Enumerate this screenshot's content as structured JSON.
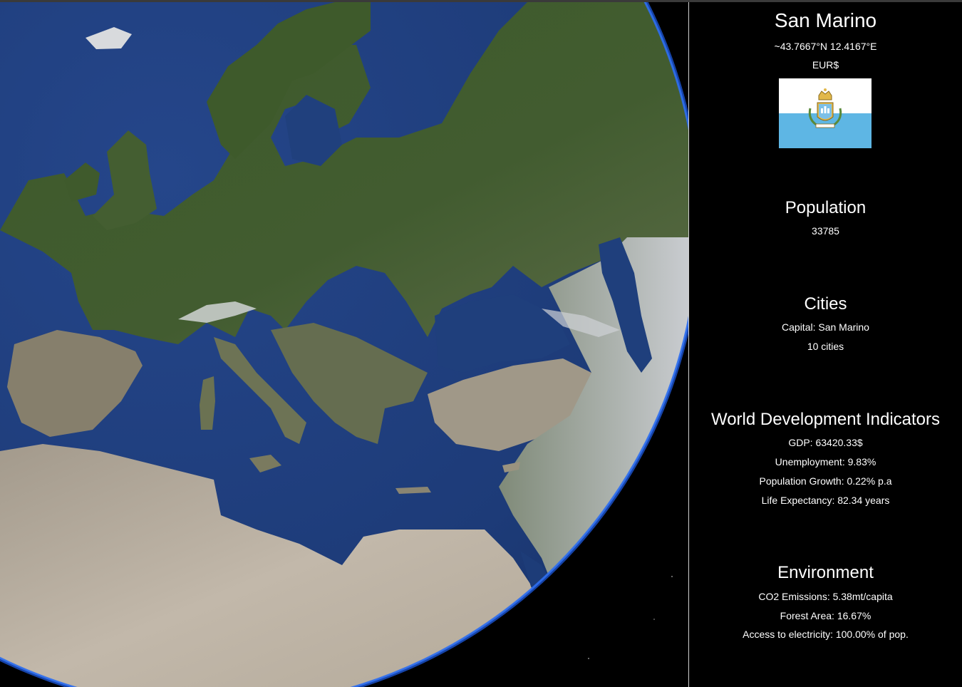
{
  "country": {
    "name": "San Marino",
    "coordinates": "~43.7667°N 12.4167°E",
    "currency": "EUR$",
    "flag": {
      "top_color": "#ffffff",
      "bottom_color": "#5eb6e4",
      "emblem_icon": "san-marino-coat-of-arms-icon"
    }
  },
  "population": {
    "title": "Population",
    "value": "33785"
  },
  "cities": {
    "title": "Cities",
    "capital": "Capital: San Marino",
    "count": "10 cities"
  },
  "wdi": {
    "title": "World Development Indicators",
    "gdp": "GDP: 63420.33$",
    "unemployment": "Unemployment: 9.83%",
    "population_growth": "Population Growth: 0.22% p.a",
    "life_expectancy": "Life Expectancy: 82.34 years"
  },
  "environment": {
    "title": "Environment",
    "co2": "CO2 Emissions: 5.38mt/capita",
    "forest": "Forest Area: 16.67%",
    "electricity": "Access to electricity: 100.00% of pop."
  },
  "colors": {
    "ocean": "#1e3d7a",
    "land_green": "#3f5b2c",
    "desert": "#b7ada0",
    "atmosphere": "#2a5fd6",
    "panel_background": "#000000",
    "panel_text": "#ffffff"
  }
}
